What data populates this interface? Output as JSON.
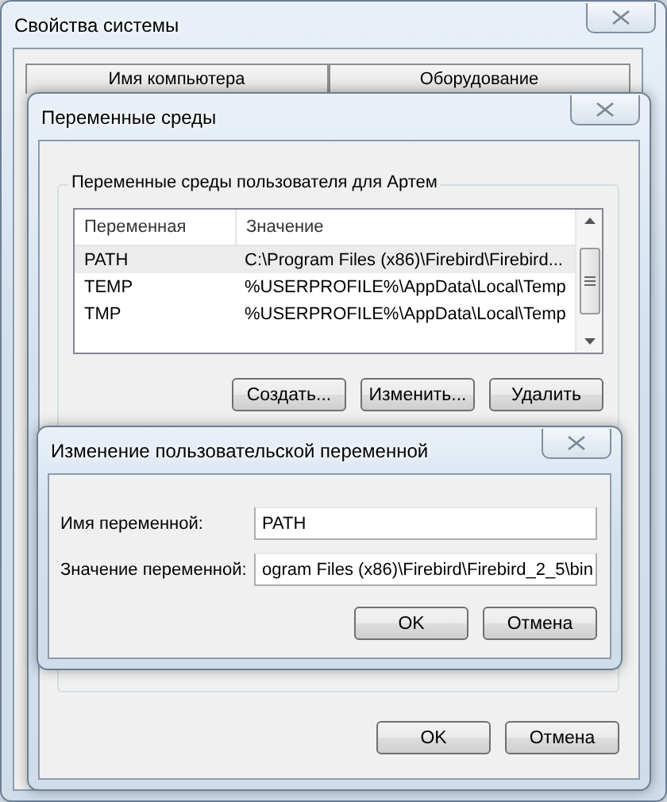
{
  "system_properties": {
    "title": "Свойства системы",
    "tabs": [
      {
        "label": "Имя компьютера",
        "selected": false
      },
      {
        "label": "Оборудование",
        "selected": false
      }
    ]
  },
  "environment_variables": {
    "title": "Переменные среды",
    "group_title": "Переменные среды пользователя для Артем",
    "table": {
      "columns": [
        "Переменная",
        "Значение"
      ],
      "rows": [
        {
          "cells": [
            "PATH",
            "C:\\Program Files (x86)\\Firebird\\Firebird..."
          ],
          "selected": true
        },
        {
          "cells": [
            "TEMP",
            "%USERPROFILE%\\AppData\\Local\\Temp"
          ],
          "selected": false
        },
        {
          "cells": [
            "TMP",
            "%USERPROFILE%\\AppData\\Local\\Temp"
          ],
          "selected": false
        }
      ]
    },
    "buttons": [
      "Создать...",
      "Изменить...",
      "Удалить"
    ],
    "bottom_buttons": [
      "OK",
      "Отмена"
    ]
  },
  "edit_dialog": {
    "title": "Изменение пользовательской переменной",
    "fields": [
      {
        "label": "Имя переменной:",
        "value": "PATH"
      },
      {
        "label": "Значение переменной:",
        "value": "ogram Files (x86)\\Firebird\\Firebird_2_5\\bin"
      }
    ],
    "buttons": [
      "OK",
      "Отмена"
    ]
  }
}
